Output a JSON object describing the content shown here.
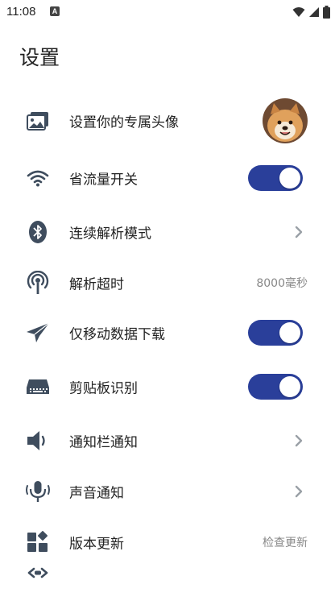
{
  "status_bar": {
    "time": "11:08",
    "notification_icon": "A",
    "icons": [
      "wifi-icon",
      "cellular-signal-icon",
      "battery-icon"
    ]
  },
  "page": {
    "title": "设置"
  },
  "settings": {
    "avatar": {
      "label": "设置你的专属头像",
      "icon": "image-icon"
    },
    "data_saver": {
      "label": "省流量开关",
      "icon": "wifi-icon",
      "enabled": true
    },
    "continuous_parse": {
      "label": "连续解析模式",
      "icon": "bluetooth-icon"
    },
    "parse_timeout": {
      "label": "解析超时",
      "icon": "broadcast-icon",
      "value": "8000毫秒"
    },
    "mobile_download": {
      "label": "仅移动数据下载",
      "icon": "paper-plane-icon",
      "enabled": true
    },
    "clipboard": {
      "label": "剪贴板识别",
      "icon": "keyboard-icon",
      "enabled": true
    },
    "notification_bar": {
      "label": "通知栏通知",
      "icon": "speaker-icon"
    },
    "sound": {
      "label": "声音通知",
      "icon": "microphone-icon"
    },
    "update": {
      "label": "版本更新",
      "icon": "widgets-icon",
      "value": "检查更新"
    }
  },
  "colors": {
    "icon": "#3f4d5e",
    "toggle_on": "#2a3f9a",
    "chevron": "#9aa0a6",
    "value_text": "#888888"
  }
}
